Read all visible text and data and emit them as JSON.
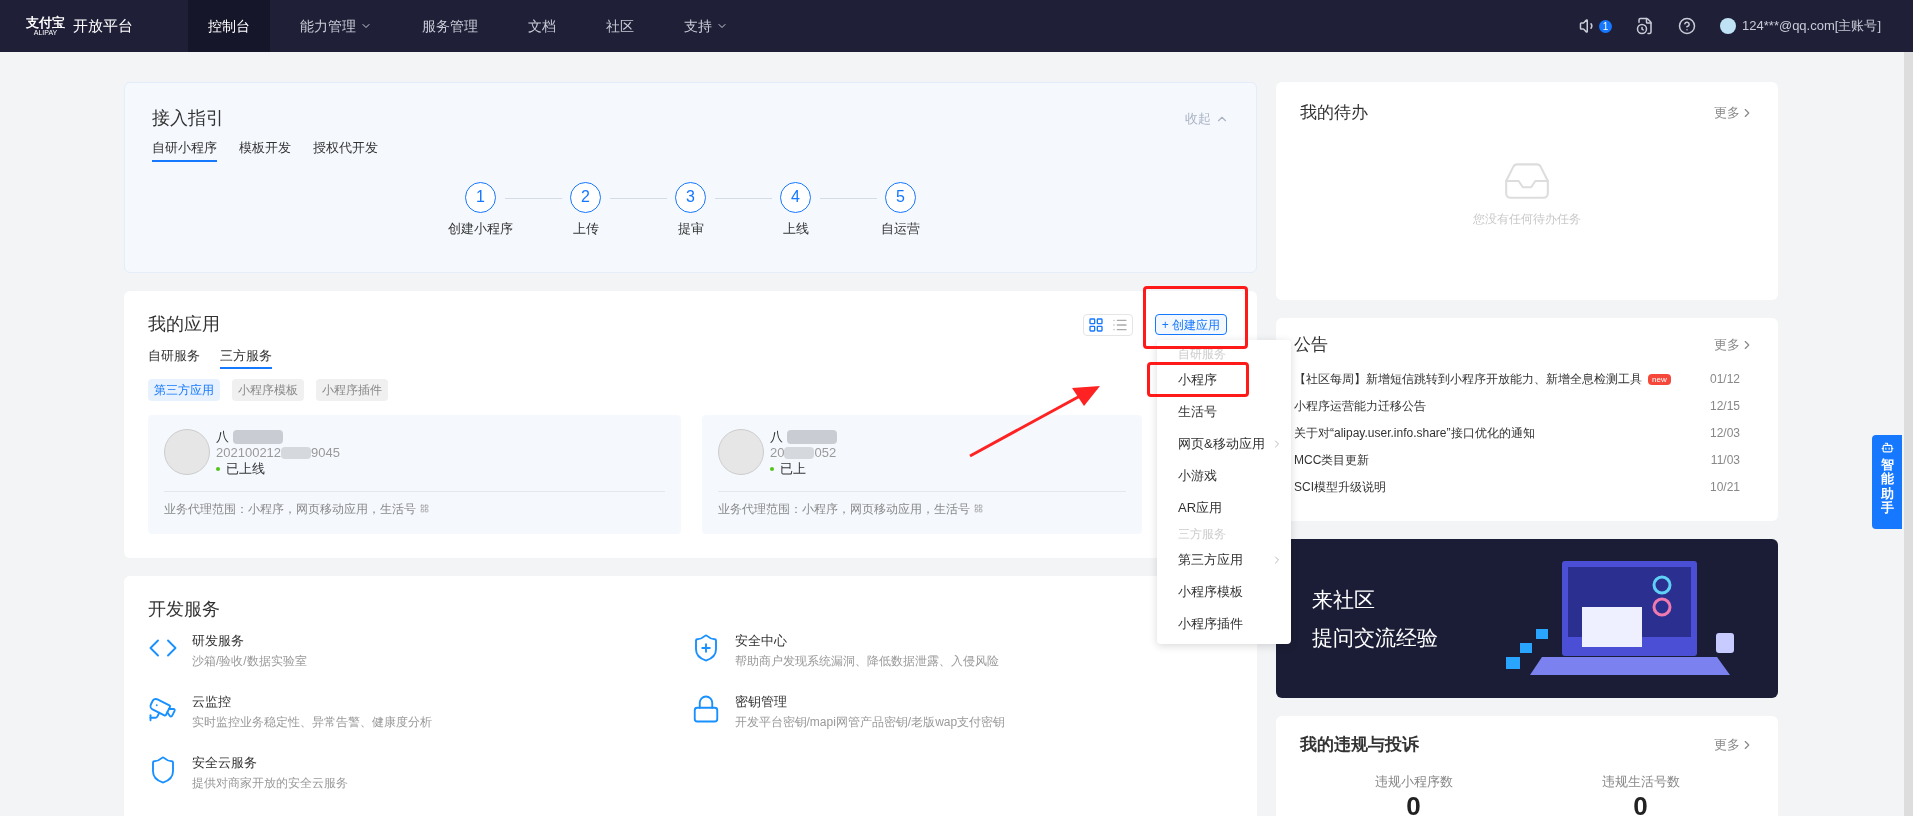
{
  "nav": {
    "logo_mark": "支付宝",
    "logo_sub": "ALIPAY",
    "brand": "开放平台",
    "items": [
      {
        "label": "控制台",
        "selected": true,
        "has_dropdown": false
      },
      {
        "label": "能力管理",
        "selected": false,
        "has_dropdown": true
      },
      {
        "label": "服务管理",
        "selected": false,
        "has_dropdown": false
      },
      {
        "label": "文档",
        "selected": false,
        "has_dropdown": false
      },
      {
        "label": "社区",
        "selected": false,
        "has_dropdown": false
      },
      {
        "label": "支持",
        "selected": false,
        "has_dropdown": true
      }
    ],
    "notification_count": "1",
    "user": "124***@qq.com[主账号]"
  },
  "guide": {
    "title": "接入指引",
    "collapse": "收起",
    "tabs": [
      {
        "label": "自研小程序",
        "selected": true
      },
      {
        "label": "模板开发",
        "selected": false
      },
      {
        "label": "授权代开发",
        "selected": false
      }
    ],
    "steps": [
      {
        "number": "1",
        "label": "创建小程序"
      },
      {
        "number": "2",
        "label": "上传"
      },
      {
        "number": "3",
        "label": "提审"
      },
      {
        "number": "4",
        "label": "上线"
      },
      {
        "number": "5",
        "label": "自运营"
      }
    ]
  },
  "apps": {
    "title": "我的应用",
    "create_button": "+ 创建应用",
    "views": [
      {
        "kind": "grid",
        "selected": true
      },
      {
        "kind": "list",
        "selected": false
      }
    ],
    "tabs": [
      {
        "label": "自研服务",
        "selected": false
      },
      {
        "label": "三方服务",
        "selected": true
      }
    ],
    "filters": [
      {
        "label": "第三方应用",
        "selected": true
      },
      {
        "label": "小程序模板",
        "selected": false
      },
      {
        "label": "小程序插件",
        "selected": false
      }
    ],
    "cards": [
      {
        "name": "八",
        "id_start": "202100212",
        "id_end": "9045",
        "status": "已上线",
        "scope": "业务代理范围：小程序，网页移动应用，生活号"
      },
      {
        "name": "八",
        "id_start": "20",
        "id_end": "052",
        "status": "已上",
        "scope": "业务代理范围：小程序，网页移动应用，生活号"
      }
    ]
  },
  "create_menu": [
    {
      "kind": "group",
      "label": "自研服务"
    },
    {
      "kind": "item",
      "label": "小程序",
      "has_submenu": false
    },
    {
      "kind": "item",
      "label": "生活号",
      "has_submenu": false
    },
    {
      "kind": "item",
      "label": "网页&移动应用",
      "has_submenu": true
    },
    {
      "kind": "item",
      "label": "小游戏",
      "has_submenu": false
    },
    {
      "kind": "item",
      "label": "AR应用",
      "has_submenu": false
    },
    {
      "kind": "group",
      "label": "三方服务"
    },
    {
      "kind": "item",
      "label": "第三方应用",
      "has_submenu": true
    },
    {
      "kind": "item",
      "label": "小程序模板",
      "has_submenu": false
    },
    {
      "kind": "item",
      "label": "小程序插件",
      "has_submenu": false
    }
  ],
  "dev_services": {
    "title": "开发服务",
    "items": [
      {
        "kind": "code",
        "title": "研发服务",
        "desc": "沙箱/验收/数据实验室"
      },
      {
        "kind": "shield-plus",
        "title": "安全中心",
        "desc": "帮助商户发现系统漏洞、降低数据泄露、入侵风险"
      },
      {
        "kind": "monitor",
        "title": "云监控",
        "desc": "实时监控业务稳定性、异常告警、健康度分析"
      },
      {
        "kind": "lock",
        "title": "密钥管理",
        "desc": "开发平台密钥/mapi网管产品密钥/老版wap支付密钥"
      },
      {
        "kind": "shield-cloud",
        "title": "安全云服务",
        "desc": "提供对商家开放的安全云服务"
      }
    ]
  },
  "todo": {
    "title": "我的待办",
    "more": "更多",
    "empty_text": "您没有任何待办任务"
  },
  "notices": {
    "title": "公告",
    "more": "更多",
    "items": [
      {
        "text": "【社区每周】新增短信跳转到小程序开放能力、新增全息检测工具",
        "badge": "new",
        "date": "01/12"
      },
      {
        "text": "小程序运营能力迁移公告",
        "date": "12/15"
      },
      {
        "text": "关于对“alipay.user.info.share”接口优化的通知",
        "date": "12/03"
      },
      {
        "text": "MCC类目更新",
        "date": "11/03"
      },
      {
        "text": "SCI模型升级说明",
        "date": "10/21"
      }
    ]
  },
  "banner": {
    "lines": [
      "来社区",
      "提问交流经验"
    ]
  },
  "violations": {
    "title": "我的违规与投诉",
    "more": "更多",
    "stats": [
      {
        "label": "违规小程序数",
        "value": "0"
      },
      {
        "label": "违规生活号数",
        "value": "0"
      }
    ]
  },
  "assistant": "智能助手"
}
